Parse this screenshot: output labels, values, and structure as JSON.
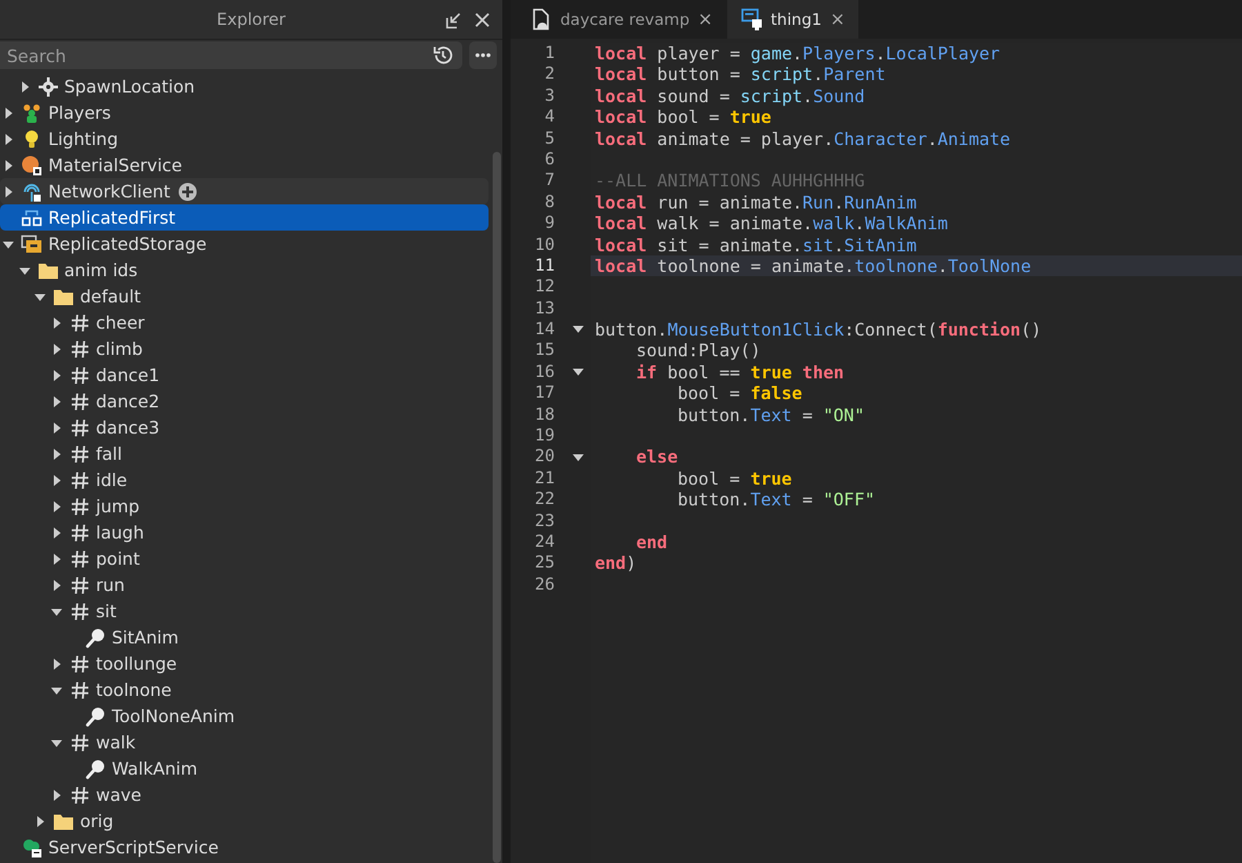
{
  "explorer": {
    "title": "Explorer",
    "search": {
      "placeholder": "Search"
    },
    "tree": [
      {
        "children": [
          {
            "label": "SpawnLocation",
            "kind": "spawn",
            "expanded": false,
            "selected": false
          }
        ]
      },
      {
        "label": "Players",
        "kind": "players",
        "expanded": false,
        "selected": false
      },
      {
        "label": "Lighting",
        "kind": "lighting",
        "expanded": false,
        "selected": false
      },
      {
        "label": "MaterialService",
        "kind": "material",
        "expanded": false,
        "selected": false
      },
      {
        "label": "NetworkClient",
        "kind": "network",
        "expanded": false,
        "selected": false,
        "hovered": true
      },
      {
        "label": "ReplicatedFirst",
        "kind": "first",
        "selected": true
      },
      {
        "label": "ReplicatedStorage",
        "kind": "storage",
        "expanded": true,
        "selected": false,
        "children": [
          {
            "label": "anim ids",
            "kind": "folder",
            "expanded": true,
            "selected": false,
            "children": [
              {
                "label": "default",
                "kind": "folder",
                "expanded": true,
                "selected": false,
                "children": [
                  {
                    "label": "cheer",
                    "kind": "value",
                    "expanded": false,
                    "selected": false
                  },
                  {
                    "label": "climb",
                    "kind": "value",
                    "expanded": false,
                    "selected": false
                  },
                  {
                    "label": "dance1",
                    "kind": "value",
                    "expanded": false,
                    "selected": false
                  },
                  {
                    "label": "dance2",
                    "kind": "value",
                    "expanded": false,
                    "selected": false
                  },
                  {
                    "label": "dance3",
                    "kind": "value",
                    "expanded": false,
                    "selected": false
                  },
                  {
                    "label": "fall",
                    "kind": "value",
                    "expanded": false,
                    "selected": false
                  },
                  {
                    "label": "idle",
                    "kind": "value",
                    "expanded": false,
                    "selected": false
                  },
                  {
                    "label": "jump",
                    "kind": "value",
                    "expanded": false,
                    "selected": false
                  },
                  {
                    "label": "laugh",
                    "kind": "value",
                    "expanded": false,
                    "selected": false
                  },
                  {
                    "label": "point",
                    "kind": "value",
                    "expanded": false,
                    "selected": false
                  },
                  {
                    "label": "run",
                    "kind": "value",
                    "expanded": false,
                    "selected": false
                  },
                  {
                    "label": "sit",
                    "kind": "value",
                    "expanded": true,
                    "selected": false,
                    "children": [
                      {
                        "label": "SitAnim",
                        "kind": "animation",
                        "selected": false
                      }
                    ]
                  },
                  {
                    "label": "toollunge",
                    "kind": "value",
                    "expanded": false,
                    "selected": false
                  },
                  {
                    "label": "toolnone",
                    "kind": "value",
                    "expanded": true,
                    "selected": false,
                    "children": [
                      {
                        "label": "ToolNoneAnim",
                        "kind": "animation",
                        "selected": false
                      }
                    ]
                  },
                  {
                    "label": "walk",
                    "kind": "value",
                    "expanded": true,
                    "selected": false,
                    "children": [
                      {
                        "label": "WalkAnim",
                        "kind": "animation",
                        "selected": false
                      }
                    ]
                  },
                  {
                    "label": "wave",
                    "kind": "value",
                    "expanded": false,
                    "selected": false
                  }
                ]
              },
              {
                "label": "orig",
                "kind": "folder",
                "expanded": false,
                "selected": false
              }
            ]
          }
        ]
      },
      {
        "label": "ServerScriptService",
        "kind": "server",
        "selected": false
      }
    ]
  },
  "editor": {
    "tabs": [
      {
        "label": "daycare revamp",
        "kind": "place",
        "selected": false,
        "close": "×"
      },
      {
        "label": "thing1",
        "kind": "script",
        "selected": true,
        "close": "×"
      }
    ],
    "lines": [
      {
        "number": "1",
        "tokens": [
          {
            "kind": "keyword",
            "text": "local"
          },
          {
            "kind": "plain",
            "text": " player = "
          },
          {
            "kind": "global",
            "text": "game"
          },
          {
            "kind": "plain",
            "text": "."
          },
          {
            "kind": "member",
            "text": "Players"
          },
          {
            "kind": "plain",
            "text": "."
          },
          {
            "kind": "member",
            "text": "LocalPlayer"
          }
        ]
      },
      {
        "number": "2",
        "tokens": [
          {
            "kind": "keyword",
            "text": "local"
          },
          {
            "kind": "plain",
            "text": " button = "
          },
          {
            "kind": "global",
            "text": "script"
          },
          {
            "kind": "plain",
            "text": "."
          },
          {
            "kind": "member",
            "text": "Parent"
          }
        ]
      },
      {
        "number": "3",
        "tokens": [
          {
            "kind": "keyword",
            "text": "local"
          },
          {
            "kind": "plain",
            "text": " sound = "
          },
          {
            "kind": "global",
            "text": "script"
          },
          {
            "kind": "plain",
            "text": "."
          },
          {
            "kind": "member",
            "text": "Sound"
          }
        ]
      },
      {
        "number": "4",
        "tokens": [
          {
            "kind": "keyword",
            "text": "local"
          },
          {
            "kind": "plain",
            "text": " bool = "
          },
          {
            "kind": "bool",
            "text": "true"
          }
        ]
      },
      {
        "number": "5",
        "tokens": [
          {
            "kind": "keyword",
            "text": "local"
          },
          {
            "kind": "plain",
            "text": " animate = player."
          },
          {
            "kind": "member",
            "text": "Character"
          },
          {
            "kind": "plain",
            "text": "."
          },
          {
            "kind": "member",
            "text": "Animate"
          }
        ]
      },
      {
        "number": "6"
      },
      {
        "number": "7",
        "tokens": [
          {
            "kind": "comment",
            "text": "--ALL ANIMATIONS AUHHGHHHG"
          }
        ]
      },
      {
        "number": "8",
        "tokens": [
          {
            "kind": "keyword",
            "text": "local"
          },
          {
            "kind": "plain",
            "text": " run = animate."
          },
          {
            "kind": "member",
            "text": "Run"
          },
          {
            "kind": "plain",
            "text": "."
          },
          {
            "kind": "member",
            "text": "RunAnim"
          }
        ]
      },
      {
        "number": "9",
        "tokens": [
          {
            "kind": "keyword",
            "text": "local"
          },
          {
            "kind": "plain",
            "text": " walk = animate."
          },
          {
            "kind": "member",
            "text": "walk"
          },
          {
            "kind": "plain",
            "text": "."
          },
          {
            "kind": "member",
            "text": "WalkAnim"
          }
        ]
      },
      {
        "number": "10",
        "tokens": [
          {
            "kind": "keyword",
            "text": "local"
          },
          {
            "kind": "plain",
            "text": " sit = animate."
          },
          {
            "kind": "member",
            "text": "sit"
          },
          {
            "kind": "plain",
            "text": "."
          },
          {
            "kind": "member",
            "text": "SitAnim"
          }
        ]
      },
      {
        "number": "11",
        "current": true,
        "tokens": [
          {
            "kind": "keyword",
            "text": "local"
          },
          {
            "kind": "plain",
            "text": " toolnone = animate."
          },
          {
            "kind": "member",
            "text": "toolnone"
          },
          {
            "kind": "plain",
            "text": "."
          },
          {
            "kind": "member",
            "text": "ToolNone"
          }
        ]
      },
      {
        "number": "12"
      },
      {
        "number": "13"
      },
      {
        "number": "14",
        "expanded": true,
        "tokens": [
          {
            "kind": "plain",
            "text": "button."
          },
          {
            "kind": "member",
            "text": "MouseButton1Click"
          },
          {
            "kind": "plain",
            "text": ":Connect("
          },
          {
            "kind": "keyword",
            "text": "function"
          },
          {
            "kind": "plain",
            "text": "()"
          }
        ],
        "children": [
          {
            "number": "15",
            "tokens": [
              {
                "kind": "plain",
                "text": "sound:Play()"
              }
            ]
          },
          {
            "number": "16",
            "expanded": true,
            "tokens": [
              {
                "kind": "keyword",
                "text": "if"
              },
              {
                "kind": "plain",
                "text": " bool == "
              },
              {
                "kind": "bool",
                "text": "true"
              },
              {
                "kind": "keyword",
                "text": " then"
              }
            ],
            "children": [
              {
                "number": "17",
                "tokens": [
                  {
                    "kind": "plain",
                    "text": "bool = "
                  },
                  {
                    "kind": "bool",
                    "text": "false"
                  }
                ]
              },
              {
                "number": "18",
                "tokens": [
                  {
                    "kind": "plain",
                    "text": "button."
                  },
                  {
                    "kind": "member",
                    "text": "Text"
                  },
                  {
                    "kind": "plain",
                    "text": " = "
                  },
                  {
                    "kind": "string",
                    "text": "\"ON\""
                  }
                ]
              },
              {
                "number": "19"
              }
            ]
          },
          {
            "number": "20",
            "expanded": true,
            "tokens": [
              {
                "kind": "keyword",
                "text": "else"
              }
            ],
            "children": [
              {
                "number": "21",
                "tokens": [
                  {
                    "kind": "plain",
                    "text": "bool = "
                  },
                  {
                    "kind": "bool",
                    "text": "true"
                  }
                ]
              },
              {
                "number": "22",
                "tokens": [
                  {
                    "kind": "plain",
                    "text": "button."
                  },
                  {
                    "kind": "member",
                    "text": "Text"
                  },
                  {
                    "kind": "plain",
                    "text": " = "
                  },
                  {
                    "kind": "string",
                    "text": "\"OFF\""
                  }
                ]
              },
              {
                "number": "23"
              }
            ]
          },
          {
            "number": "24",
            "tokens": [
              {
                "kind": "keyword",
                "text": "end"
              }
            ]
          }
        ]
      },
      {
        "number": "25",
        "tokens": [
          {
            "kind": "keyword",
            "text": "end"
          },
          {
            "kind": "plain",
            "text": ")"
          }
        ]
      },
      {
        "number": "26"
      }
    ]
  }
}
